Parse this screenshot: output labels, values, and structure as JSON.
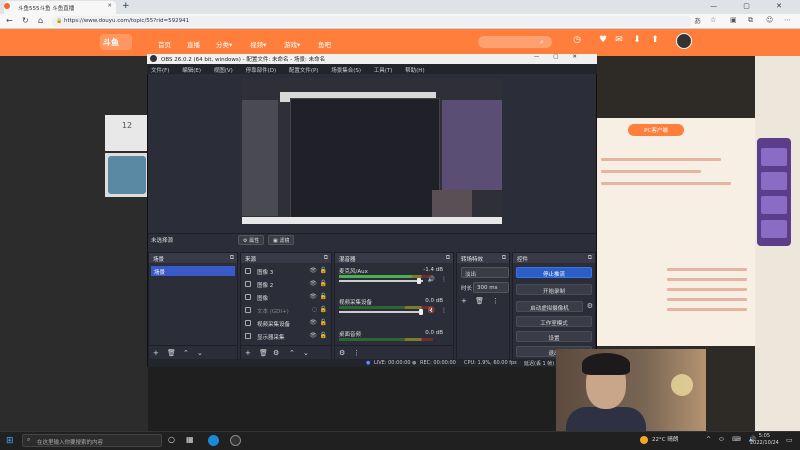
{
  "browser": {
    "tab_title": "斗鱼555斗鱼 斗鱼直播",
    "url": "https://www.douyu.com/topic/55?rid=592941",
    "win_controls": "— ▢ ✕"
  },
  "site": {
    "logo": "斗鱼",
    "nav": [
      "首页",
      "直播",
      "分类▾",
      "视频▾",
      "游戏▾",
      "鱼吧"
    ],
    "follow_button": "PC客户端"
  },
  "left_card": {
    "count": "12"
  },
  "obs": {
    "title": "OBS 26.0.2 (64 bit, windows) - 配置文件: 未命名 - 场景: 未命名",
    "menu": [
      "文件(F)",
      "编辑(E)",
      "视图(V)",
      "停靠部件(D)",
      "配置文件(P)",
      "场景集合(S)",
      "工具(T)",
      "帮助(H)"
    ],
    "no_source": "未选择源",
    "props_button": "⚙ 属性",
    "filters_button": "滤镜",
    "scenes": {
      "header": "场景",
      "items": [
        "场景"
      ]
    },
    "sources": {
      "header": "来源",
      "items": [
        {
          "label": "图像 3",
          "dim": false
        },
        {
          "label": "图像 2",
          "dim": false
        },
        {
          "label": "图像",
          "dim": false
        },
        {
          "label": "文本 (GDI+)",
          "dim": true
        },
        {
          "label": "视频采集设备",
          "dim": false
        },
        {
          "label": "显示器采集",
          "dim": false
        }
      ]
    },
    "mixer": {
      "header": "混音器",
      "channels": [
        {
          "name": "麦克风/Aux",
          "db": "-1.4 dB",
          "level": 0.78
        },
        {
          "name": "视频采集设备",
          "db": "0.0 dB",
          "level": 0.0
        },
        {
          "name": "桌面音频",
          "db": "0.0 dB",
          "level": 0.0
        }
      ]
    },
    "transitions": {
      "header": "转场特效",
      "selected": "淡出",
      "duration_label": "时长",
      "duration": "300 ms"
    },
    "controls": {
      "header": "控件",
      "buttons": [
        "停止推流",
        "开始录制",
        "启动虚拟摄像机",
        "工作室模式",
        "设置",
        "退出"
      ]
    },
    "status": {
      "live": "LIVE: 00:00:00",
      "rec": "REC: 00:00:00",
      "cpu": "CPU: 1.9%, 60.00 fps",
      "delay": "延迟(丢 1 帧) 0.0%"
    }
  },
  "taskbar": {
    "search_placeholder": "在这里输入你要搜索的内容",
    "weather": "22°C 晴朗",
    "time": "5:05",
    "date": "2022/10/24"
  }
}
